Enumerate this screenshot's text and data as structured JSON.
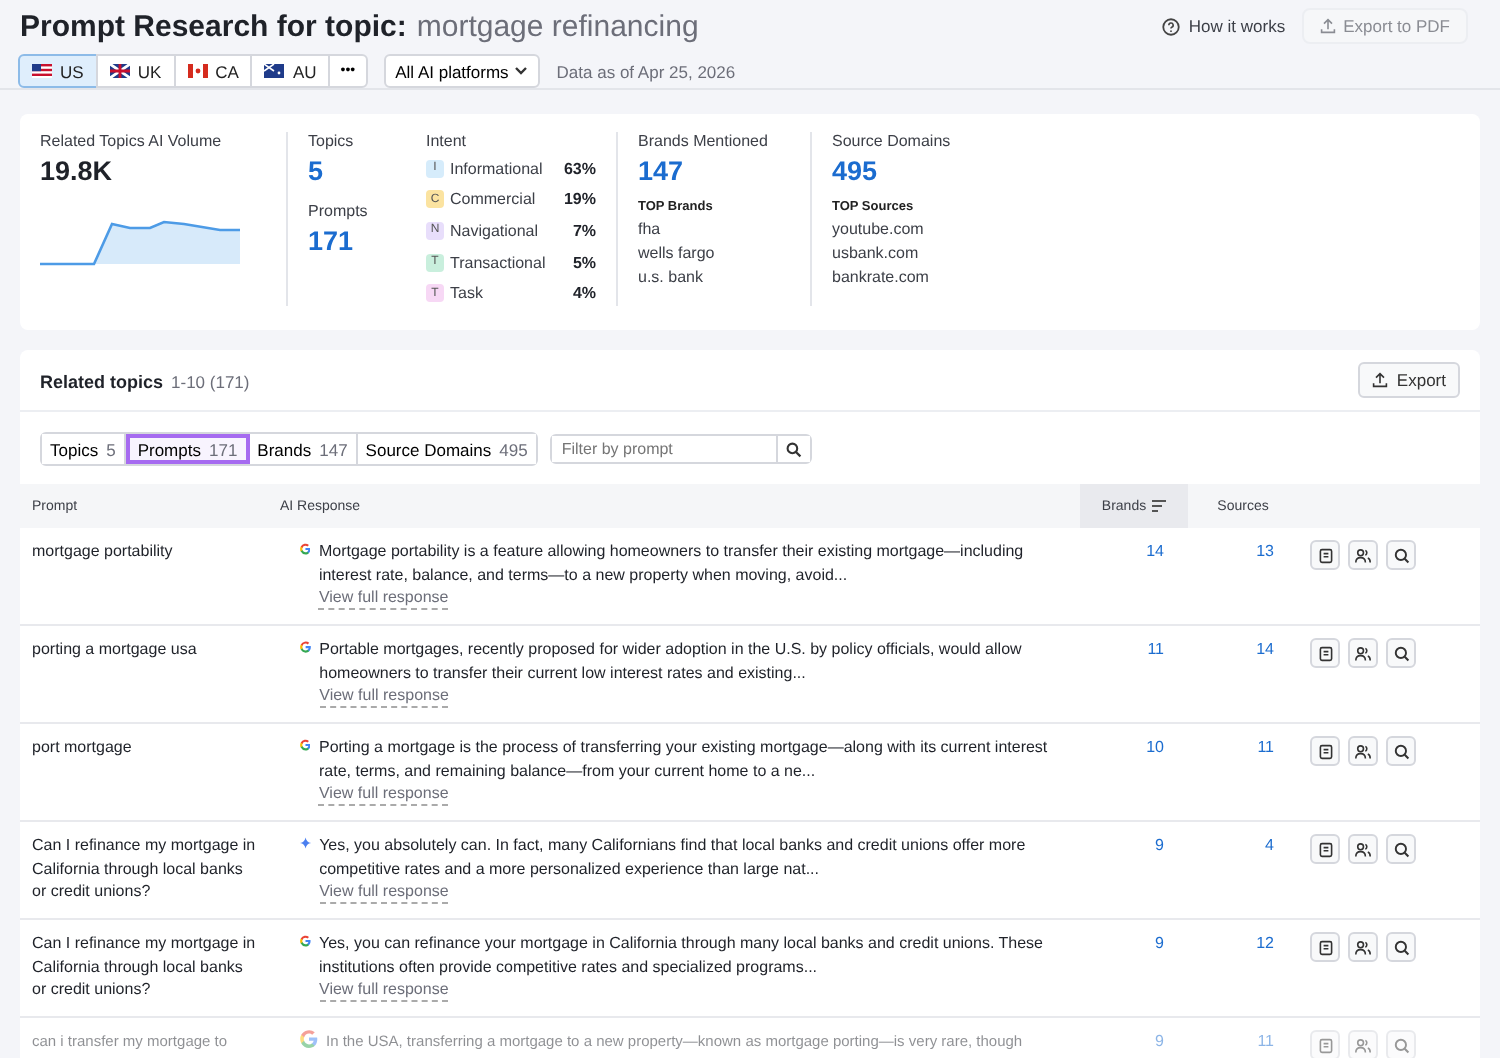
{
  "header": {
    "title": "Prompt Research for topic:",
    "topic": "mortgage refinancing",
    "how_it_works": "How it works",
    "export_pdf": {
      "label": "Export to PDF",
      "disabled": true
    }
  },
  "countries": [
    {
      "code": "US",
      "kind": "us",
      "selected": true
    },
    {
      "code": "UK",
      "kind": "uk",
      "selected": false
    },
    {
      "code": "CA",
      "kind": "ca",
      "selected": false
    },
    {
      "code": "AU",
      "kind": "au",
      "selected": false
    }
  ],
  "more": "•••",
  "platform_select": "All AI platforms",
  "data_as_of": "Data as of Apr 25, 2026",
  "stats": {
    "volume_label": "Related Topics AI Volume",
    "volume": "19.8K",
    "topics_label": "Topics",
    "topics": "5",
    "prompts_label": "Prompts",
    "prompts": "171",
    "intent_label": "Intent",
    "intents": [
      {
        "letter": "I",
        "name": "Informational",
        "share": "63%",
        "color": "#d6ecfb"
      },
      {
        "letter": "C",
        "name": "Commercial",
        "share": "19%",
        "color": "#fbe3a0"
      },
      {
        "letter": "N",
        "name": "Navigational",
        "share": "7%",
        "color": "#e8defb"
      },
      {
        "letter": "T",
        "name": "Transactional",
        "share": "5%",
        "color": "#c9efdd"
      },
      {
        "letter": "T",
        "name": "Task",
        "share": "4%",
        "color": "#f7d8f5"
      }
    ],
    "brands_label": "Brands Mentioned",
    "brands": "147",
    "top_brands_label": "TOP Brands",
    "top_brands": [
      "fha",
      "wells fargo",
      "u.s. bank"
    ],
    "sources_label": "Source Domains",
    "sources": "495",
    "top_sources_label": "TOP Sources",
    "top_sources": [
      "youtube.com",
      "usbank.com",
      "bankrate.com"
    ]
  },
  "related": {
    "title": "Related topics",
    "range": "1-10 (171)",
    "export": "Export",
    "filters": [
      {
        "label": "Topics",
        "count": "5",
        "selected": false
      },
      {
        "label": "Prompts",
        "count": "171",
        "selected": true
      },
      {
        "label": "Brands",
        "count": "147",
        "selected": false
      },
      {
        "label": "Source Domains",
        "count": "495",
        "selected": false
      }
    ],
    "filter_placeholder": "Filter by prompt",
    "columns": [
      "Prompt",
      "AI Response",
      "Brands",
      "Sources"
    ],
    "rows": [
      {
        "prompt": "mortgage portability",
        "kind": "google",
        "response": "Mortgage portability is a feature allowing homeowners to transfer their existing mortgage—including interest rate, balance, and terms—to a new property when moving, avoid...",
        "link": "View full response",
        "brands": "14",
        "sources": "13"
      },
      {
        "prompt": "porting a mortgage usa",
        "kind": "google",
        "response": "Portable mortgages, recently proposed for wider adoption in the U.S. by policy officials, would allow homeowners to transfer their current low interest rates and existing...",
        "link": "View full response",
        "brands": "11",
        "sources": "14"
      },
      {
        "prompt": "port mortgage",
        "kind": "google",
        "response": "Porting a mortgage is the process of transferring your existing mortgage—along with its current interest rate, terms, and remaining balance—from your current home to a ne...",
        "link": "View full response",
        "brands": "10",
        "sources": "11"
      },
      {
        "prompt": "Can I refinance my mortgage in California through local banks or credit unions?",
        "kind": "gemini",
        "response": "Yes, you absolutely can. In fact, many Californians find that local banks and credit unions offer more competitive rates and a more personalized experience than large nat...",
        "link": "View full response",
        "brands": "9",
        "sources": "4"
      },
      {
        "prompt": "Can I refinance my mortgage in California through local banks or credit unions?",
        "kind": "google",
        "response": "Yes, you can refinance your mortgage in California through many local banks and credit unions. These institutions often provide competitive rates and specialized programs...",
        "link": "View full response",
        "brands": "9",
        "sources": "12"
      },
      {
        "prompt": "can i transfer my mortgage to",
        "kind": "google",
        "response": "In the USA, transferring a mortgage to a new property—known as mortgage porting—is very rare, though",
        "brands": "9",
        "sources": "11"
      }
    ]
  }
}
